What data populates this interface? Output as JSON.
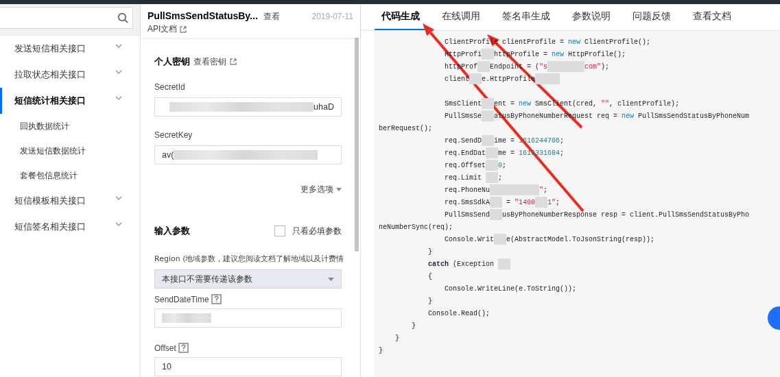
{
  "sidebar": {
    "items": [
      {
        "label": "发送短信相关接口",
        "selected": false
      },
      {
        "label": "拉取状态相关接口",
        "selected": false
      },
      {
        "label": "短信统计相关接口",
        "selected": true,
        "children": [
          {
            "label": "回执数据统计",
            "selected": false
          },
          {
            "label": "发送短信数据统计",
            "selected": false
          },
          {
            "label": "套餐包信息统计",
            "selected": false
          }
        ]
      },
      {
        "label": "短信模板相关接口",
        "selected": false
      },
      {
        "label": "短信签名相关接口",
        "selected": false
      }
    ]
  },
  "api_header": {
    "title": "PullSmsSendStatusBy...",
    "view_link": "查看",
    "date": "2019-07-11",
    "doc_link": "API文档"
  },
  "secret": {
    "heading": "个人密钥",
    "view_link": "查看密钥",
    "fields": [
      {
        "label": "SecretId",
        "value": "uhaD",
        "kind": "masked_before"
      },
      {
        "label": "SecretKey",
        "value": "av(",
        "kind": "masked_after"
      }
    ],
    "more_options": "更多选项"
  },
  "inputs": {
    "heading": "输入参数",
    "required_only": {
      "label": "只看必填参数",
      "checked": false
    },
    "region": {
      "label": "Region (地域参数，建议您阅读文档了解地域以及计费情",
      "value": "本接口不需要传递该参数"
    },
    "fields": [
      {
        "label": "SendDateTime",
        "kind": "masked"
      },
      {
        "label": "Offset",
        "value": "10",
        "kind": "plain"
      }
    ]
  },
  "tabs": [
    {
      "label": "代码生成",
      "selected": true
    },
    {
      "label": "在线调用",
      "selected": false
    },
    {
      "label": "签名串生成",
      "selected": false
    },
    {
      "label": "参数说明",
      "selected": false
    },
    {
      "label": "问题反馈",
      "selected": false
    },
    {
      "label": "查看文档",
      "selected": false
    }
  ],
  "code": [
    {
      "kind": "code",
      "segments": [
        {
          "kind": "plain",
          "text": "                ClientProfile clientProfile = "
        },
        {
          "kind": "keyword",
          "text": "new"
        },
        {
          "kind": "plain",
          "text": " ClientProfile();"
        }
      ]
    },
    {
      "kind": "code",
      "segments": [
        {
          "kind": "plain",
          "text": "                HttpProfi"
        },
        {
          "kind": "blur"
        },
        {
          "kind": "plain",
          "text": "httpProfile = "
        },
        {
          "kind": "keyword",
          "text": "new"
        },
        {
          "kind": "plain",
          "text": " HttpProfile();"
        }
      ]
    },
    {
      "kind": "code",
      "segments": [
        {
          "kind": "plain",
          "text": "                httpProf"
        },
        {
          "kind": "blur"
        },
        {
          "kind": "plain",
          "text": "Endpoint = ("
        },
        {
          "kind": "string",
          "text": "\"s"
        },
        {
          "kind": "blur"
        },
        {
          "kind": "blur"
        },
        {
          "kind": "blur"
        },
        {
          "kind": "string",
          "text": "com\""
        },
        {
          "kind": "plain",
          "text": ");"
        }
      ]
    },
    {
      "kind": "code",
      "segments": [
        {
          "kind": "plain",
          "text": "                client"
        },
        {
          "kind": "blur"
        },
        {
          "kind": "plain",
          "text": "e.HttpProfile"
        },
        {
          "kind": "blur"
        },
        {
          "kind": "blur"
        }
      ]
    },
    {
      "kind": "blank"
    },
    {
      "kind": "code",
      "segments": [
        {
          "kind": "plain",
          "text": "                SmsClient"
        },
        {
          "kind": "blur"
        },
        {
          "kind": "plain",
          "text": "ent = "
        },
        {
          "kind": "keyword",
          "text": "new"
        },
        {
          "kind": "plain",
          "text": " SmsClient(cred, "
        },
        {
          "kind": "string",
          "text": "\"\""
        },
        {
          "kind": "plain",
          "text": ", clientProfile);"
        }
      ]
    },
    {
      "kind": "code",
      "segments": [
        {
          "kind": "plain",
          "text": "                PullSmsSe"
        },
        {
          "kind": "blur"
        },
        {
          "kind": "plain",
          "text": "atusByPhoneNumberRequest req = "
        },
        {
          "kind": "keyword",
          "text": "new"
        },
        {
          "kind": "plain",
          "text": " PullSmsSendStatusByPhoneNum"
        }
      ]
    },
    {
      "kind": "code",
      "segments": [
        {
          "kind": "plain",
          "text": "berRequest();"
        }
      ]
    },
    {
      "kind": "code",
      "segments": [
        {
          "kind": "plain",
          "text": "                req.SendD"
        },
        {
          "kind": "blur"
        },
        {
          "kind": "plain",
          "text": "ime = "
        },
        {
          "kind": "number",
          "text": "1616244706"
        },
        {
          "kind": "plain",
          "text": ";"
        }
      ]
    },
    {
      "kind": "code",
      "segments": [
        {
          "kind": "plain",
          "text": "                req.EndDat"
        },
        {
          "kind": "blur"
        },
        {
          "kind": "plain",
          "text": "me = "
        },
        {
          "kind": "number",
          "text": "1616331684"
        },
        {
          "kind": "plain",
          "text": ";"
        }
      ]
    },
    {
      "kind": "code",
      "segments": [
        {
          "kind": "plain",
          "text": "                req.Offset"
        },
        {
          "kind": "blur"
        },
        {
          "kind": "number",
          "text": "0"
        },
        {
          "kind": "plain",
          "text": ";"
        }
      ]
    },
    {
      "kind": "code",
      "segments": [
        {
          "kind": "plain",
          "text": "                req.Limit "
        },
        {
          "kind": "blur"
        },
        {
          "kind": "plain",
          "text": ";"
        }
      ]
    },
    {
      "kind": "code",
      "segments": [
        {
          "kind": "plain",
          "text": "                req.PhoneNu"
        },
        {
          "kind": "blur"
        },
        {
          "kind": "blur"
        },
        {
          "kind": "blur"
        },
        {
          "kind": "blur"
        },
        {
          "kind": "string",
          "text": "\""
        },
        {
          "kind": "plain",
          "text": ";"
        }
      ]
    },
    {
      "kind": "code",
      "segments": [
        {
          "kind": "plain",
          "text": "                req.SmsSdkA"
        },
        {
          "kind": "blur"
        },
        {
          "kind": "plain",
          "text": " = "
        },
        {
          "kind": "string",
          "text": "\"1400"
        },
        {
          "kind": "blur"
        },
        {
          "kind": "string",
          "text": "1\""
        },
        {
          "kind": "plain",
          "text": ";"
        }
      ]
    },
    {
      "kind": "code",
      "segments": [
        {
          "kind": "plain",
          "text": "                PullSmsSend"
        },
        {
          "kind": "blur"
        },
        {
          "kind": "plain",
          "text": "usByPhoneNumberResponse resp = client.PullSmsSendStatusByPho"
        }
      ]
    },
    {
      "kind": "code",
      "segments": [
        {
          "kind": "plain",
          "text": "neNumberSync(req);"
        }
      ]
    },
    {
      "kind": "code",
      "segments": [
        {
          "kind": "plain",
          "text": "                Console.Writ"
        },
        {
          "kind": "blur"
        },
        {
          "kind": "plain",
          "text": "e(AbstractModel.ToJsonString(resp));"
        }
      ]
    },
    {
      "kind": "code",
      "segments": [
        {
          "kind": "plain",
          "text": "            }"
        }
      ]
    },
    {
      "kind": "code",
      "segments": [
        {
          "kind": "keyword_bold",
          "text": "            catch"
        },
        {
          "kind": "plain",
          "text": " (Exception "
        },
        {
          "kind": "blur"
        }
      ]
    },
    {
      "kind": "code",
      "segments": [
        {
          "kind": "plain",
          "text": "            {"
        }
      ]
    },
    {
      "kind": "code",
      "segments": [
        {
          "kind": "plain",
          "text": "                Console.WriteLine(e.ToString());"
        }
      ]
    },
    {
      "kind": "code",
      "segments": [
        {
          "kind": "plain",
          "text": "            }"
        }
      ]
    },
    {
      "kind": "code",
      "segments": [
        {
          "kind": "plain",
          "text": "            Console.Read();"
        }
      ]
    },
    {
      "kind": "code",
      "segments": [
        {
          "kind": "plain",
          "text": "        }"
        }
      ]
    },
    {
      "kind": "code",
      "segments": [
        {
          "kind": "plain",
          "text": "    }"
        }
      ]
    },
    {
      "kind": "code",
      "segments": [
        {
          "kind": "plain",
          "text": "}"
        }
      ]
    }
  ],
  "annotations": [
    {
      "kind": "arrow"
    },
    {
      "kind": "arrow"
    }
  ]
}
